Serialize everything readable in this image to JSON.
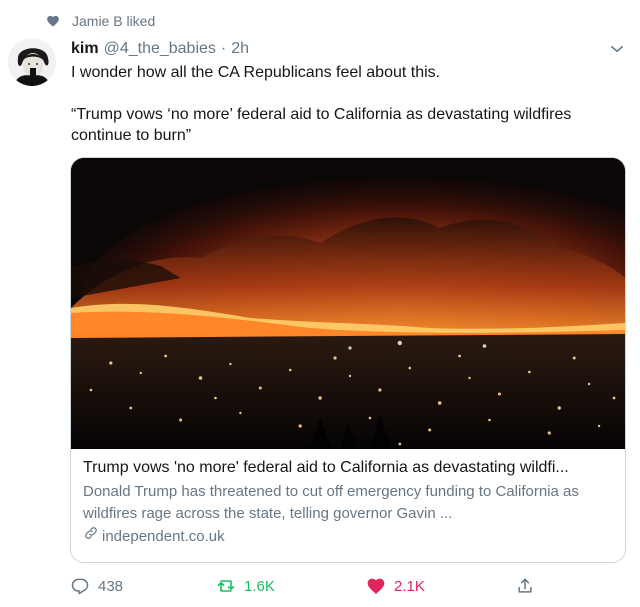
{
  "social_context": {
    "icon": "heart-icon",
    "text": "Jamie B liked"
  },
  "tweet": {
    "author_name": "kim",
    "handle": "@4_the_babies",
    "separator": "·",
    "time": "2h",
    "text_line1": "I wonder how all the CA Republicans feel about this.",
    "text_line2": "“Trump vows ‘no more’ federal aid to California as devastating wildfires continue to burn”"
  },
  "card": {
    "image_alt": "Night wildfire burning on hills above city lights",
    "title": "Trump vows 'no more' federal aid to California as devastating wildfi...",
    "description": "Donald Trump has threatened to cut off emergency funding to California as wildfires rage across the state, telling governor Gavin ...",
    "domain": "independent.co.uk"
  },
  "actions": {
    "reply_count": "438",
    "retweet_count": "1.6K",
    "like_count": "2.1K"
  },
  "colors": {
    "text_primary": "#14171a",
    "text_secondary": "#657786",
    "retweet_active": "#17bf63",
    "like_active": "#e0245e",
    "border": "#ccd6dd"
  }
}
